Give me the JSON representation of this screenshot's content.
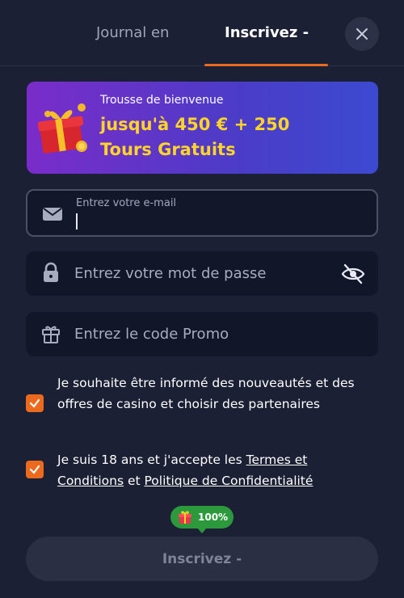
{
  "tabs": {
    "login": "Journal en",
    "signup": "Inscrivez -"
  },
  "banner": {
    "subtitle": "Trousse de bienvenue",
    "title": "jusqu'à 450 € + 250 Tours Gratuits"
  },
  "form": {
    "email_label": "Entrez votre e-mail",
    "password_placeholder": "Entrez votre mot de passe",
    "promo_placeholder": "Entrez le code Promo"
  },
  "consents": {
    "newsletter": "Je souhaite être informé des nouveautés et des offres de casino et choisir des partenaires",
    "terms_prefix": "Je suis 18 ans et j'accepte les ",
    "terms_link": "Termes et Conditions",
    "terms_and": " et ",
    "privacy_link": "Politique de Confidentialité"
  },
  "progress": {
    "label": "100%",
    "value": 100
  },
  "submit_label": "Inscrivez -",
  "colors": {
    "accent": "#ea6a1e",
    "badge": "#2c9a3c",
    "banner_text": "#ffd428"
  }
}
